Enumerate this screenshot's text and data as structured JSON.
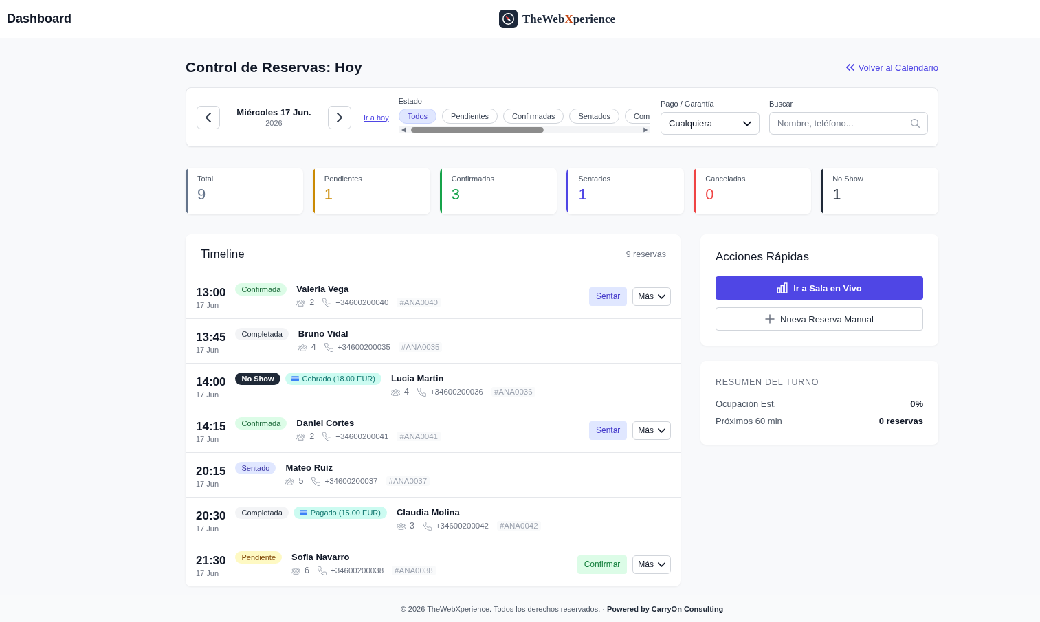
{
  "header": {
    "title": "Dashboard",
    "logo": [
      {
        "text": "TheWeb",
        "accent": false
      },
      {
        "text": "X",
        "accent": true
      },
      {
        "text": "perience",
        "accent": false
      }
    ]
  },
  "page": {
    "title": "Control de Reservas: Hoy",
    "back_link": "Volver al Calendario"
  },
  "filters": {
    "date": {
      "day": "Miércoles 17 Jun.",
      "year": "2026"
    },
    "today_link": "Ir a hoy",
    "status": {
      "label": "Estado",
      "chips": [
        {
          "label": "Todos",
          "selected": true
        },
        {
          "label": "Pendientes",
          "selected": false
        },
        {
          "label": "Confirmadas",
          "selected": false
        },
        {
          "label": "Sentados",
          "selected": false
        },
        {
          "label": "Com",
          "selected": false
        }
      ]
    },
    "payment": {
      "label": "Pago / Garantía",
      "value": "Cualquiera"
    },
    "search": {
      "label": "Buscar",
      "placeholder": "Nombre, teléfono..."
    }
  },
  "stats": [
    {
      "label": "Total",
      "value": "9",
      "color": "#64748b"
    },
    {
      "label": "Pendientes",
      "value": "1",
      "color": "#ca8a04"
    },
    {
      "label": "Confirmadas",
      "value": "3",
      "color": "#16a34a"
    },
    {
      "label": "Sentados",
      "value": "1",
      "color": "#4f46e5"
    },
    {
      "label": "Canceladas",
      "value": "0",
      "color": "#ef4444"
    },
    {
      "label": "No Show",
      "value": "1",
      "color": "#1f2937"
    }
  ],
  "timeline": {
    "title": "Timeline",
    "count": "9 reservas",
    "rows": [
      {
        "time": "13:00",
        "date": "17 Jun",
        "status": {
          "kind": "confirmada",
          "label": "Confirmada"
        },
        "name": "Valeria Vega",
        "guests": "2",
        "phone": "+34600200040",
        "code": "#ANA0040",
        "action": {
          "kind": "seat",
          "label": "Sentar"
        },
        "more": "Más"
      },
      {
        "time": "13:45",
        "date": "17 Jun",
        "status": {
          "kind": "completada",
          "label": "Completada"
        },
        "name": "Bruno Vidal",
        "guests": "4",
        "phone": "+34600200035",
        "code": "#ANA0035"
      },
      {
        "time": "14:00",
        "date": "17 Jun",
        "status": {
          "kind": "no_show",
          "label": "No Show"
        },
        "payment": "Cobrado (18.00 EUR)",
        "name": "Lucia Martin",
        "guests": "4",
        "phone": "+34600200036",
        "code": "#ANA0036"
      },
      {
        "time": "14:15",
        "date": "17 Jun",
        "status": {
          "kind": "confirmada",
          "label": "Confirmada"
        },
        "name": "Daniel Cortes",
        "guests": "2",
        "phone": "+34600200041",
        "code": "#ANA0041",
        "action": {
          "kind": "seat",
          "label": "Sentar"
        },
        "more": "Más"
      },
      {
        "time": "20:15",
        "date": "17 Jun",
        "status": {
          "kind": "sentado",
          "label": "Sentado"
        },
        "name": "Mateo Ruiz",
        "guests": "5",
        "phone": "+34600200037",
        "code": "#ANA0037"
      },
      {
        "time": "20:30",
        "date": "17 Jun",
        "status": {
          "kind": "completada",
          "label": "Completada"
        },
        "payment": "Pagado (15.00 EUR)",
        "name": "Claudia Molina",
        "guests": "3",
        "phone": "+34600200042",
        "code": "#ANA0042"
      },
      {
        "time": "21:30",
        "date": "17 Jun",
        "status": {
          "kind": "pendiente",
          "label": "Pendiente"
        },
        "name": "Sofia Navarro",
        "guests": "6",
        "phone": "+34600200038",
        "code": "#ANA0038",
        "action": {
          "kind": "confirm",
          "label": "Confirmar"
        },
        "more": "Más"
      }
    ]
  },
  "quick_actions": {
    "title": "Acciones Rápidas",
    "buttons": [
      {
        "kind": "primary",
        "label": "Ir a Sala en Vivo"
      },
      {
        "kind": "secondary",
        "label": "Nueva Reserva Manual"
      }
    ]
  },
  "summary": {
    "title": "RESUMEN DEL TURNO",
    "rows": [
      {
        "label": "Ocupación Est.",
        "value": "0%"
      },
      {
        "label": "Próximos 60 min",
        "value": "0 reservas"
      }
    ]
  },
  "footer": "© 2026 TheWebXperience. Todos los derechos reservados. · **Powered by CarryOn Consulting**"
}
